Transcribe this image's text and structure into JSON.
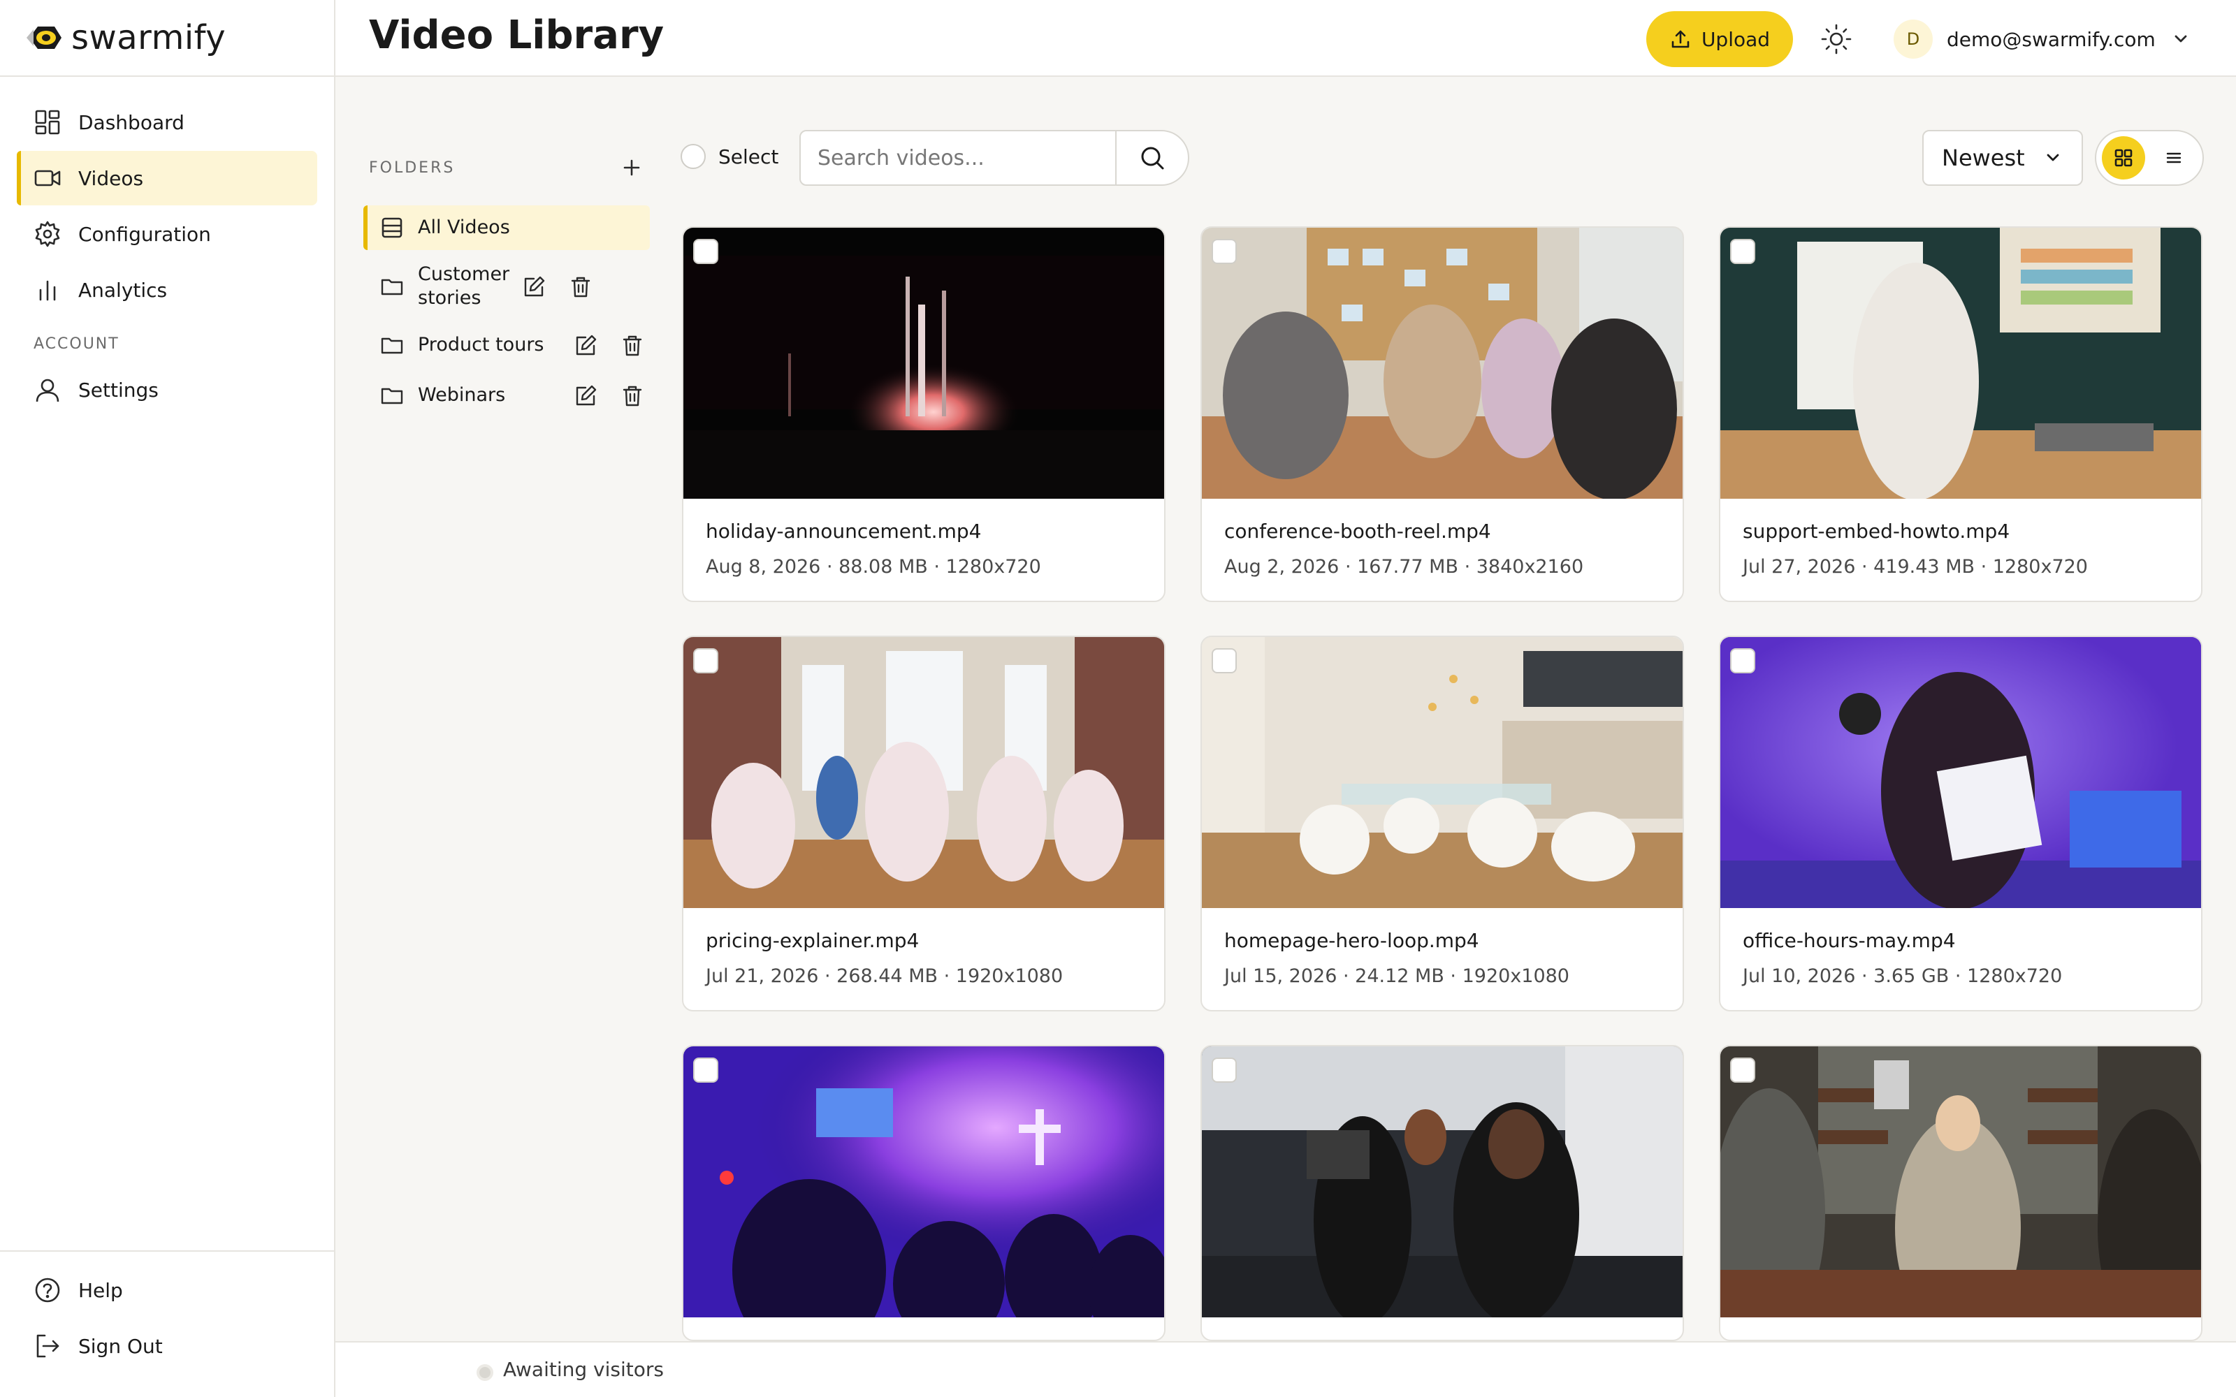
{
  "app": {
    "logo_text": "swarmify",
    "brand_color": "#f5cf1e"
  },
  "sidebar": {
    "items": [
      {
        "label": "Dashboard",
        "icon": "dashboard-icon"
      },
      {
        "label": "Videos",
        "icon": "video-camera-icon",
        "active": true
      },
      {
        "label": "Configuration",
        "icon": "gear-icon"
      },
      {
        "label": "Analytics",
        "icon": "bar-chart-icon"
      }
    ],
    "account_section": "ACCOUNT",
    "account_items": [
      {
        "label": "Settings",
        "icon": "user-icon"
      }
    ],
    "bottom_items": [
      {
        "label": "Help",
        "icon": "help-circle-icon"
      },
      {
        "label": "Sign Out",
        "icon": "sign-out-icon"
      }
    ]
  },
  "header": {
    "title": "Video Library",
    "upload_label": "Upload",
    "user_initial": "D",
    "user_email": "demo@swarmify.com"
  },
  "folders": {
    "title": "FOLDERS",
    "items": [
      {
        "label": "All Videos",
        "active": true
      },
      {
        "label": "Customer stories"
      },
      {
        "label": "Product tours"
      },
      {
        "label": "Webinars"
      }
    ]
  },
  "toolbar": {
    "select_label": "Select",
    "search_placeholder": "Search videos...",
    "sort_value": "Newest",
    "view_mode": "grid"
  },
  "videos": [
    {
      "title": "holiday-announcement.mp4",
      "meta": "Aug 8, 2026 · 88.08 MB · 1280x720"
    },
    {
      "title": "conference-booth-reel.mp4",
      "meta": "Aug 2, 2026 · 167.77 MB · 3840x2160"
    },
    {
      "title": "support-embed-howto.mp4",
      "meta": "Jul 27, 2026 · 419.43 MB · 1280x720"
    },
    {
      "title": "pricing-explainer.mp4",
      "meta": "Jul 21, 2026 · 268.44 MB · 1920x1080"
    },
    {
      "title": "homepage-hero-loop.mp4",
      "meta": "Jul 15, 2026 · 24.12 MB · 1920x1080"
    },
    {
      "title": "office-hours-may.mp4",
      "meta": "Jul 10, 2026 · 3.65 GB · 1280x720"
    },
    {
      "title": "",
      "meta": ""
    },
    {
      "title": "",
      "meta": ""
    },
    {
      "title": "",
      "meta": ""
    }
  ],
  "status": {
    "text": "Awaiting visitors"
  }
}
